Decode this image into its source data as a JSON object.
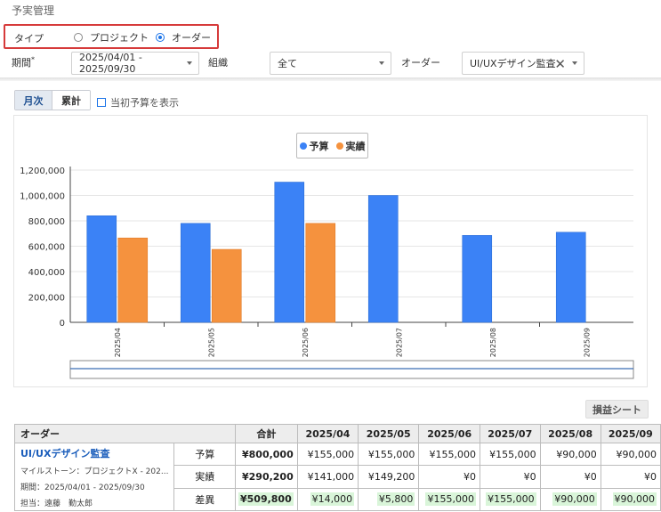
{
  "page_title": "予実管理",
  "type_selector": {
    "label": "タイプ",
    "options": [
      {
        "label": "プロジェクト",
        "selected": false
      },
      {
        "label": "オーダー",
        "selected": true
      }
    ]
  },
  "filters": {
    "period_label": "期間",
    "period_required_mark": "*",
    "period_value": "2025/04/01 - 2025/09/30",
    "org_label": "組織",
    "org_value": "全て",
    "order_label": "オーダー",
    "order_value": "UI/UXデザイン監査"
  },
  "view_toggle": {
    "monthly": "月次",
    "cumulative": "累計",
    "active": "monthly"
  },
  "initial_budget_checkbox": {
    "label": "当初予算を表示",
    "checked": false
  },
  "chart_data": {
    "type": "bar",
    "categories": [
      "2025/04",
      "2025/05",
      "2025/06",
      "2025/07",
      "2025/08",
      "2025/09"
    ],
    "series": [
      {
        "name": "予算",
        "color": "#3b82f6",
        "values": [
          840000,
          780000,
          1105000,
          1000000,
          685000,
          710000
        ]
      },
      {
        "name": "実績",
        "color": "#f5923e",
        "values": [
          665000,
          575000,
          780000,
          null,
          null,
          null
        ]
      }
    ],
    "ylim": [
      0,
      1200000
    ],
    "yticks": [
      0,
      200000,
      400000,
      600000,
      800000,
      1000000,
      1200000
    ],
    "ytick_labels": [
      "0",
      "200,000",
      "400,000",
      "600,000",
      "800,000",
      "1,000,000",
      "1,200,000"
    ],
    "legend_position": "top-center",
    "grid": true
  },
  "pl_button": "損益シート",
  "table": {
    "headers": {
      "order": "オーダー",
      "total": "合計",
      "months": [
        "2025/04",
        "2025/05",
        "2025/06",
        "2025/07",
        "2025/08",
        "2025/09"
      ]
    },
    "order": {
      "name": "UI/UXデザイン監査",
      "milestone": "マイルストーン：プロジェクトX - 202...",
      "period": "期間：2025/04/01 - 2025/09/30",
      "owner": "担当：遠藤　勤太郎"
    },
    "rows": [
      {
        "label": "予算",
        "total": "¥800,000",
        "values": [
          "¥155,000",
          "¥155,000",
          "¥155,000",
          "¥155,000",
          "¥90,000",
          "¥90,000"
        ],
        "highlight": false
      },
      {
        "label": "実績",
        "total": "¥290,200",
        "values": [
          "¥141,000",
          "¥149,200",
          "¥0",
          "¥0",
          "¥0",
          "¥0"
        ],
        "highlight": false
      },
      {
        "label": "差異",
        "total": "¥509,800",
        "values": [
          "¥14,000",
          "¥5,800",
          "¥155,000",
          "¥155,000",
          "¥90,000",
          "¥90,000"
        ],
        "highlight": true
      }
    ]
  }
}
